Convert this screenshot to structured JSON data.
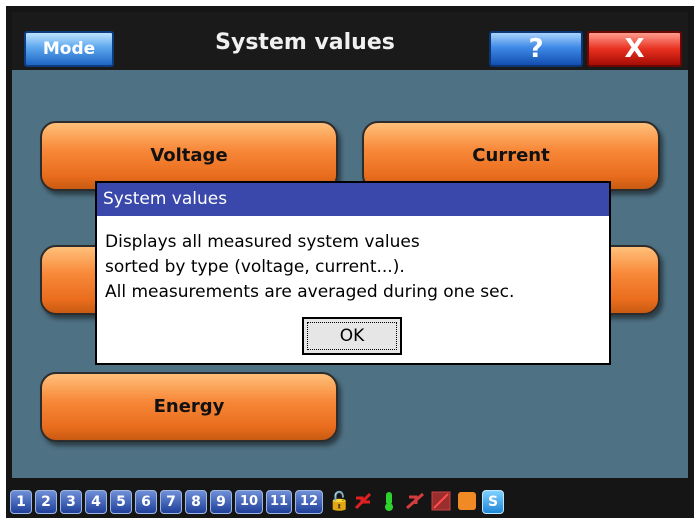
{
  "header": {
    "title": "System values",
    "mode_label": "Mode",
    "help_label": "?",
    "close_label": "X"
  },
  "menu": {
    "voltage": "Voltage",
    "current": "Current",
    "energy": "Energy"
  },
  "dialog": {
    "title": "System values",
    "lines": [
      "Displays all measured system values",
      "sorted by type (voltage, current...).",
      "All measurements are averaged during one sec."
    ],
    "ok_label": "OK"
  },
  "statusbar": {
    "channels": [
      "1",
      "2",
      "3",
      "4",
      "5",
      "6",
      "7",
      "8",
      "9",
      "10",
      "11",
      "12"
    ],
    "s_label": "S"
  }
}
